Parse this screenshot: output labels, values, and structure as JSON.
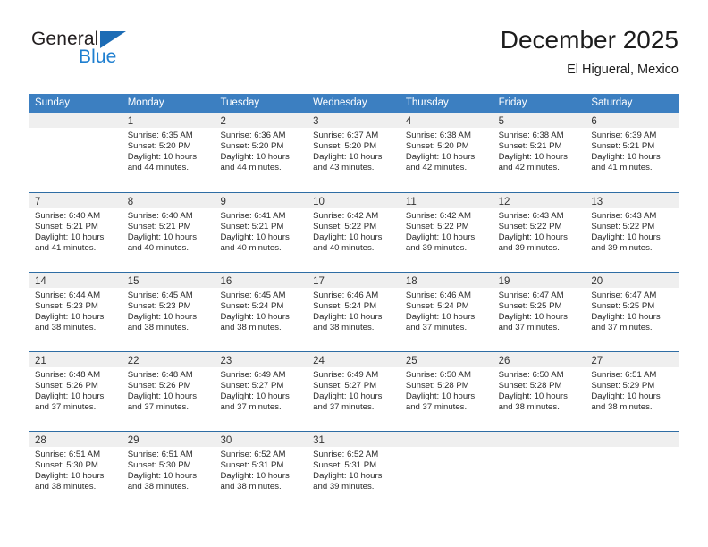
{
  "brand": {
    "name_top": "General",
    "name_bottom": "Blue"
  },
  "header": {
    "title": "December 2025",
    "location": "El Higueral, Mexico"
  },
  "colors": {
    "header_blue": "#3c7fc1",
    "separator_blue": "#2e6da4",
    "daynum_strip": "#efefef",
    "logo_blue": "#1f7fd0",
    "triangle_blue": "#1c6cb5"
  },
  "weekdays": [
    "Sunday",
    "Monday",
    "Tuesday",
    "Wednesday",
    "Thursday",
    "Friday",
    "Saturday"
  ],
  "labels": {
    "sunrise_prefix": "Sunrise:",
    "sunset_prefix": "Sunset:",
    "daylight_prefix": "Daylight:"
  },
  "weeks": [
    [
      {
        "day": "",
        "sunrise": "",
        "sunset": "",
        "daylight_l1": "",
        "daylight_l2": ""
      },
      {
        "day": "1",
        "sunrise": "Sunrise: 6:35 AM",
        "sunset": "Sunset: 5:20 PM",
        "daylight_l1": "Daylight: 10 hours",
        "daylight_l2": "and 44 minutes."
      },
      {
        "day": "2",
        "sunrise": "Sunrise: 6:36 AM",
        "sunset": "Sunset: 5:20 PM",
        "daylight_l1": "Daylight: 10 hours",
        "daylight_l2": "and 44 minutes."
      },
      {
        "day": "3",
        "sunrise": "Sunrise: 6:37 AM",
        "sunset": "Sunset: 5:20 PM",
        "daylight_l1": "Daylight: 10 hours",
        "daylight_l2": "and 43 minutes."
      },
      {
        "day": "4",
        "sunrise": "Sunrise: 6:38 AM",
        "sunset": "Sunset: 5:20 PM",
        "daylight_l1": "Daylight: 10 hours",
        "daylight_l2": "and 42 minutes."
      },
      {
        "day": "5",
        "sunrise": "Sunrise: 6:38 AM",
        "sunset": "Sunset: 5:21 PM",
        "daylight_l1": "Daylight: 10 hours",
        "daylight_l2": "and 42 minutes."
      },
      {
        "day": "6",
        "sunrise": "Sunrise: 6:39 AM",
        "sunset": "Sunset: 5:21 PM",
        "daylight_l1": "Daylight: 10 hours",
        "daylight_l2": "and 41 minutes."
      }
    ],
    [
      {
        "day": "7",
        "sunrise": "Sunrise: 6:40 AM",
        "sunset": "Sunset: 5:21 PM",
        "daylight_l1": "Daylight: 10 hours",
        "daylight_l2": "and 41 minutes."
      },
      {
        "day": "8",
        "sunrise": "Sunrise: 6:40 AM",
        "sunset": "Sunset: 5:21 PM",
        "daylight_l1": "Daylight: 10 hours",
        "daylight_l2": "and 40 minutes."
      },
      {
        "day": "9",
        "sunrise": "Sunrise: 6:41 AM",
        "sunset": "Sunset: 5:21 PM",
        "daylight_l1": "Daylight: 10 hours",
        "daylight_l2": "and 40 minutes."
      },
      {
        "day": "10",
        "sunrise": "Sunrise: 6:42 AM",
        "sunset": "Sunset: 5:22 PM",
        "daylight_l1": "Daylight: 10 hours",
        "daylight_l2": "and 40 minutes."
      },
      {
        "day": "11",
        "sunrise": "Sunrise: 6:42 AM",
        "sunset": "Sunset: 5:22 PM",
        "daylight_l1": "Daylight: 10 hours",
        "daylight_l2": "and 39 minutes."
      },
      {
        "day": "12",
        "sunrise": "Sunrise: 6:43 AM",
        "sunset": "Sunset: 5:22 PM",
        "daylight_l1": "Daylight: 10 hours",
        "daylight_l2": "and 39 minutes."
      },
      {
        "day": "13",
        "sunrise": "Sunrise: 6:43 AM",
        "sunset": "Sunset: 5:22 PM",
        "daylight_l1": "Daylight: 10 hours",
        "daylight_l2": "and 39 minutes."
      }
    ],
    [
      {
        "day": "14",
        "sunrise": "Sunrise: 6:44 AM",
        "sunset": "Sunset: 5:23 PM",
        "daylight_l1": "Daylight: 10 hours",
        "daylight_l2": "and 38 minutes."
      },
      {
        "day": "15",
        "sunrise": "Sunrise: 6:45 AM",
        "sunset": "Sunset: 5:23 PM",
        "daylight_l1": "Daylight: 10 hours",
        "daylight_l2": "and 38 minutes."
      },
      {
        "day": "16",
        "sunrise": "Sunrise: 6:45 AM",
        "sunset": "Sunset: 5:24 PM",
        "daylight_l1": "Daylight: 10 hours",
        "daylight_l2": "and 38 minutes."
      },
      {
        "day": "17",
        "sunrise": "Sunrise: 6:46 AM",
        "sunset": "Sunset: 5:24 PM",
        "daylight_l1": "Daylight: 10 hours",
        "daylight_l2": "and 38 minutes."
      },
      {
        "day": "18",
        "sunrise": "Sunrise: 6:46 AM",
        "sunset": "Sunset: 5:24 PM",
        "daylight_l1": "Daylight: 10 hours",
        "daylight_l2": "and 37 minutes."
      },
      {
        "day": "19",
        "sunrise": "Sunrise: 6:47 AM",
        "sunset": "Sunset: 5:25 PM",
        "daylight_l1": "Daylight: 10 hours",
        "daylight_l2": "and 37 minutes."
      },
      {
        "day": "20",
        "sunrise": "Sunrise: 6:47 AM",
        "sunset": "Sunset: 5:25 PM",
        "daylight_l1": "Daylight: 10 hours",
        "daylight_l2": "and 37 minutes."
      }
    ],
    [
      {
        "day": "21",
        "sunrise": "Sunrise: 6:48 AM",
        "sunset": "Sunset: 5:26 PM",
        "daylight_l1": "Daylight: 10 hours",
        "daylight_l2": "and 37 minutes."
      },
      {
        "day": "22",
        "sunrise": "Sunrise: 6:48 AM",
        "sunset": "Sunset: 5:26 PM",
        "daylight_l1": "Daylight: 10 hours",
        "daylight_l2": "and 37 minutes."
      },
      {
        "day": "23",
        "sunrise": "Sunrise: 6:49 AM",
        "sunset": "Sunset: 5:27 PM",
        "daylight_l1": "Daylight: 10 hours",
        "daylight_l2": "and 37 minutes."
      },
      {
        "day": "24",
        "sunrise": "Sunrise: 6:49 AM",
        "sunset": "Sunset: 5:27 PM",
        "daylight_l1": "Daylight: 10 hours",
        "daylight_l2": "and 37 minutes."
      },
      {
        "day": "25",
        "sunrise": "Sunrise: 6:50 AM",
        "sunset": "Sunset: 5:28 PM",
        "daylight_l1": "Daylight: 10 hours",
        "daylight_l2": "and 37 minutes."
      },
      {
        "day": "26",
        "sunrise": "Sunrise: 6:50 AM",
        "sunset": "Sunset: 5:28 PM",
        "daylight_l1": "Daylight: 10 hours",
        "daylight_l2": "and 38 minutes."
      },
      {
        "day": "27",
        "sunrise": "Sunrise: 6:51 AM",
        "sunset": "Sunset: 5:29 PM",
        "daylight_l1": "Daylight: 10 hours",
        "daylight_l2": "and 38 minutes."
      }
    ],
    [
      {
        "day": "28",
        "sunrise": "Sunrise: 6:51 AM",
        "sunset": "Sunset: 5:30 PM",
        "daylight_l1": "Daylight: 10 hours",
        "daylight_l2": "and 38 minutes."
      },
      {
        "day": "29",
        "sunrise": "Sunrise: 6:51 AM",
        "sunset": "Sunset: 5:30 PM",
        "daylight_l1": "Daylight: 10 hours",
        "daylight_l2": "and 38 minutes."
      },
      {
        "day": "30",
        "sunrise": "Sunrise: 6:52 AM",
        "sunset": "Sunset: 5:31 PM",
        "daylight_l1": "Daylight: 10 hours",
        "daylight_l2": "and 38 minutes."
      },
      {
        "day": "31",
        "sunrise": "Sunrise: 6:52 AM",
        "sunset": "Sunset: 5:31 PM",
        "daylight_l1": "Daylight: 10 hours",
        "daylight_l2": "and 39 minutes."
      },
      {
        "day": "",
        "sunrise": "",
        "sunset": "",
        "daylight_l1": "",
        "daylight_l2": ""
      },
      {
        "day": "",
        "sunrise": "",
        "sunset": "",
        "daylight_l1": "",
        "daylight_l2": ""
      },
      {
        "day": "",
        "sunrise": "",
        "sunset": "",
        "daylight_l1": "",
        "daylight_l2": ""
      }
    ]
  ]
}
